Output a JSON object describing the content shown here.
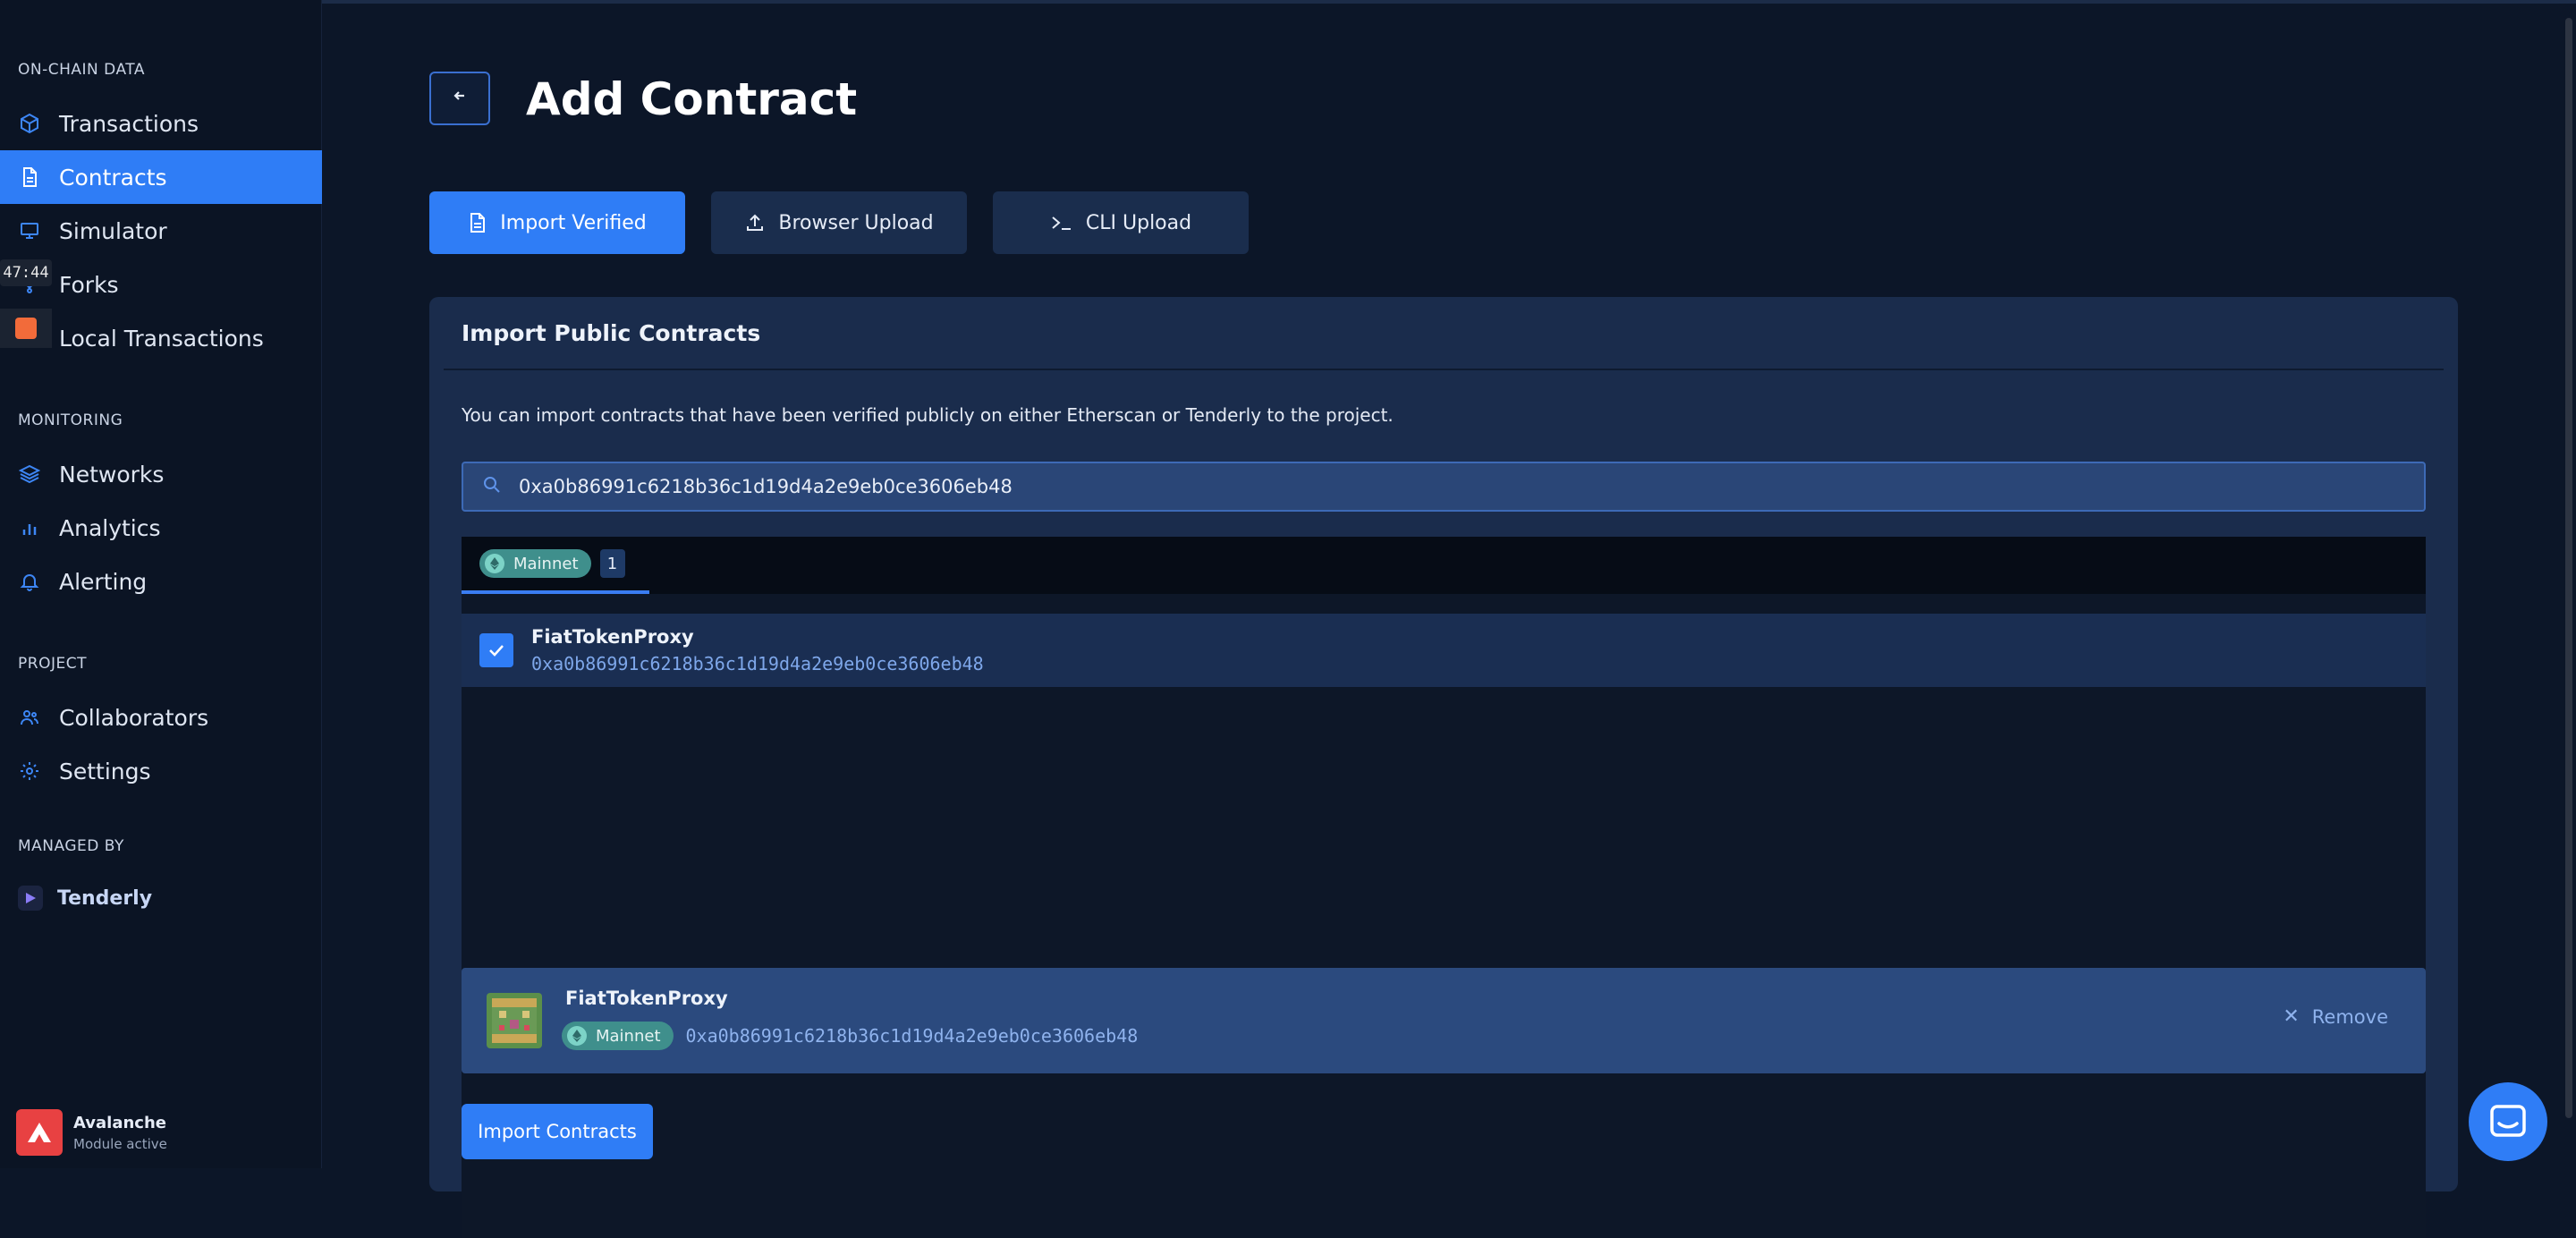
{
  "sidebar": {
    "sections": {
      "onchain": "ON-CHAIN DATA",
      "monitoring": "MONITORING",
      "project": "PROJECT",
      "managed": "MANAGED BY"
    },
    "items": {
      "transactions": "Transactions",
      "contracts": "Contracts",
      "simulator": "Simulator",
      "forks": "Forks",
      "local_transactions": "Local Transactions",
      "networks": "Networks",
      "analytics": "Analytics",
      "alerting": "Alerting",
      "collaborators": "Collaborators",
      "settings": "Settings"
    },
    "active_item": "Contracts",
    "managed_by": "Tenderly",
    "module": {
      "name": "Avalanche",
      "status": "Module active"
    },
    "overlay_timer": "47:44"
  },
  "header": {
    "title": "Add Contract",
    "back_icon": "arrow-left-icon"
  },
  "tabs": [
    {
      "label": "Import Verified",
      "icon": "document-icon",
      "active": true
    },
    {
      "label": "Browser Upload",
      "icon": "upload-icon",
      "active": false
    },
    {
      "label": "CLI Upload",
      "icon": "terminal-icon",
      "active": false
    }
  ],
  "panel": {
    "title": "Import Public Contracts",
    "description": "You can import contracts that have been verified publicly on either Etherscan or Tenderly to the project.",
    "search_value": "0xa0b86991c6218b36c1d19d4a2e9eb0ce3606eb48",
    "network_tab": {
      "label": "Mainnet",
      "count": "1"
    },
    "result": {
      "name": "FiatTokenProxy",
      "address": "0xa0b86991c6218b36c1d19d4a2e9eb0ce3606eb48",
      "checked": true
    },
    "selected": {
      "name": "FiatTokenProxy",
      "network": "Mainnet",
      "address": "0xa0b86991c6218b36c1d19d4a2e9eb0ce3606eb48",
      "remove_label": "Remove"
    },
    "import_button": "Import Contracts"
  },
  "colors": {
    "accent": "#2f7df6",
    "background": "#0c1628",
    "panel": "#1a2c4c",
    "network_teal": "#3f8f8c",
    "avalanche_red": "#e84142"
  }
}
